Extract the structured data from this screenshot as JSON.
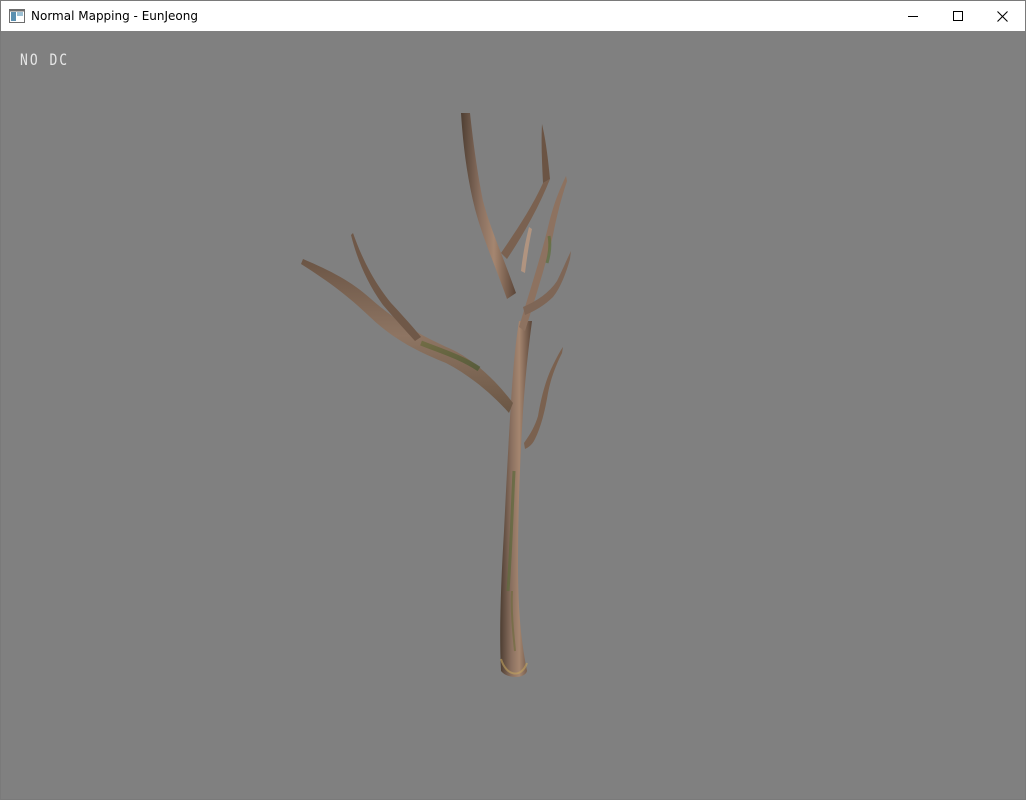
{
  "window": {
    "title": "Normal Mapping - EunJeong",
    "app_icon": "window-app-icon",
    "controls": [
      {
        "name": "minimize",
        "icon": "minimize-icon"
      },
      {
        "name": "maximize",
        "icon": "maximize-icon"
      },
      {
        "name": "close",
        "icon": "close-icon"
      }
    ]
  },
  "viewport": {
    "background_color": "#808080",
    "overlay_text": "NO DC",
    "scene_object": "dead-tree-model"
  }
}
